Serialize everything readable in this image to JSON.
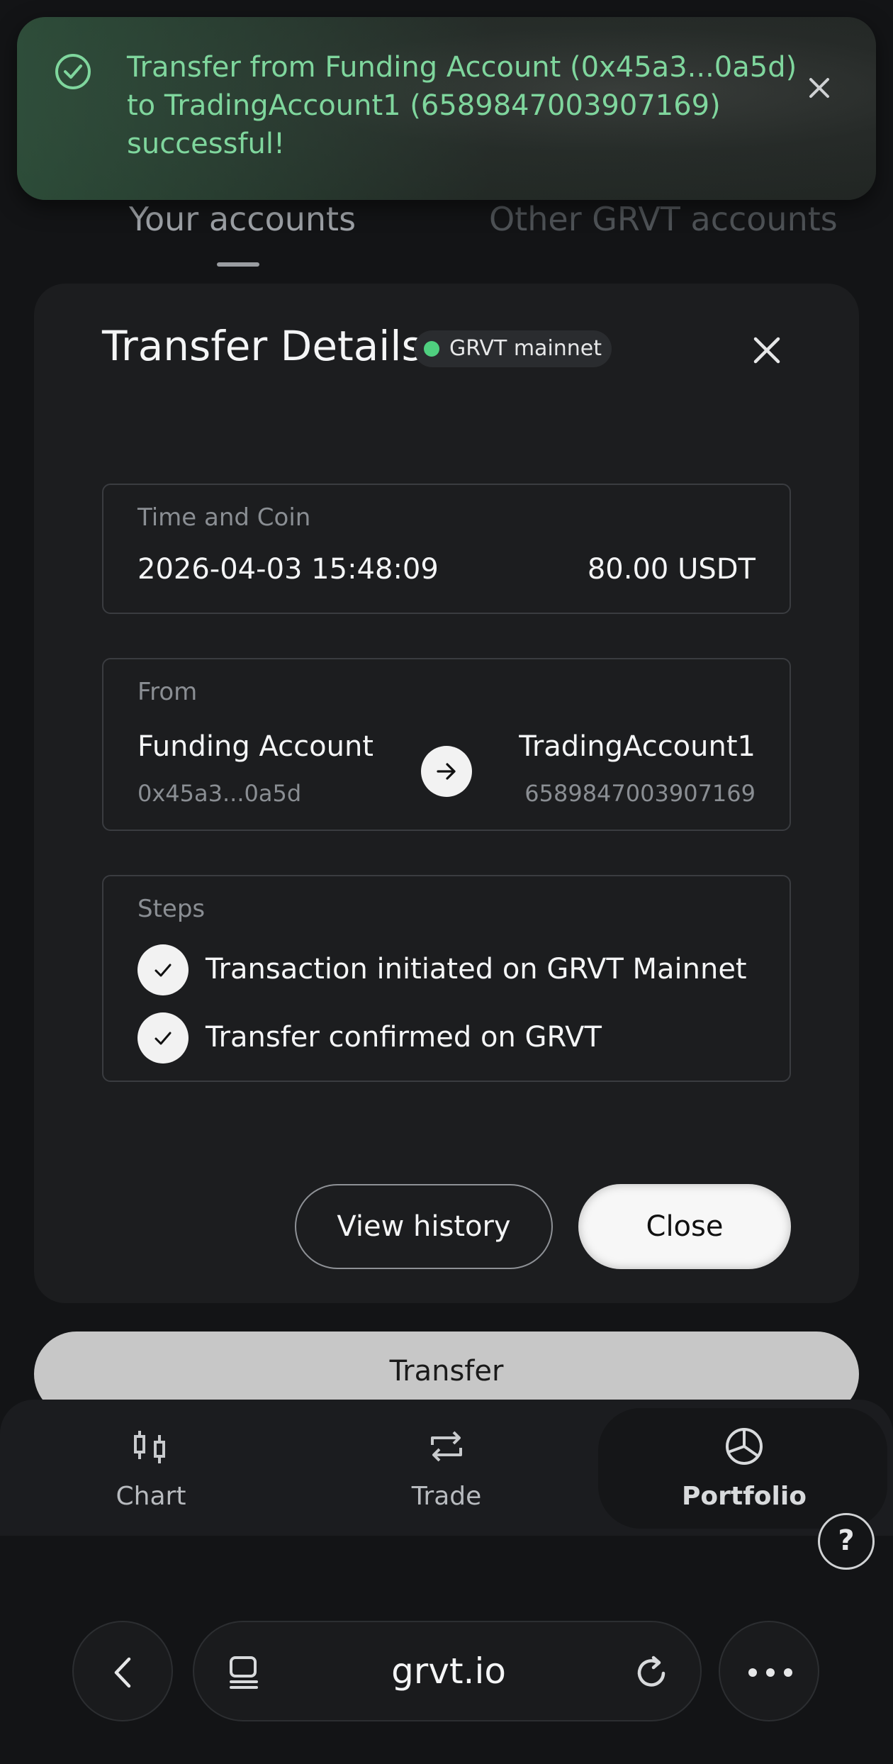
{
  "background": {
    "tabs": [
      {
        "label": "Your accounts",
        "active": true
      },
      {
        "label": "Other GRVT accounts",
        "active": false
      }
    ],
    "transfer_button": "Transfer"
  },
  "toast": {
    "message": "Transfer from Funding Account (0x45a3...0a5d) to TradingAccount1 (6589847003907169) successful!",
    "icon": "check-circle-icon",
    "color": "#7fd69d"
  },
  "modal": {
    "title": "Transfer Details",
    "network_badge": "GRVT mainnet",
    "network_color": "#4fcf7f",
    "time_coin": {
      "label": "Time and Coin",
      "time": "2026-04-03 15:48:09",
      "amount": "80.00 USDT"
    },
    "from": {
      "label": "From",
      "from_name": "Funding Account",
      "from_address": "0x45a3...0a5d",
      "to_name": "TradingAccount1",
      "to_id": "6589847003907169"
    },
    "steps": {
      "label": "Steps",
      "items": [
        {
          "text": "Transaction initiated on GRVT Mainnet",
          "done": true
        },
        {
          "text": "Transfer confirmed on GRVT",
          "done": true
        }
      ]
    },
    "buttons": {
      "history": "View history",
      "close": "Close"
    }
  },
  "bottom_nav": {
    "items": [
      {
        "label": "Chart",
        "icon": "candlestick-chart-icon"
      },
      {
        "label": "Trade",
        "icon": "swap-arrows-icon"
      },
      {
        "label": "Portfolio",
        "icon": "pie-chart-icon",
        "active": true
      }
    ],
    "help": "?"
  },
  "browser": {
    "url": "grvt.io"
  }
}
